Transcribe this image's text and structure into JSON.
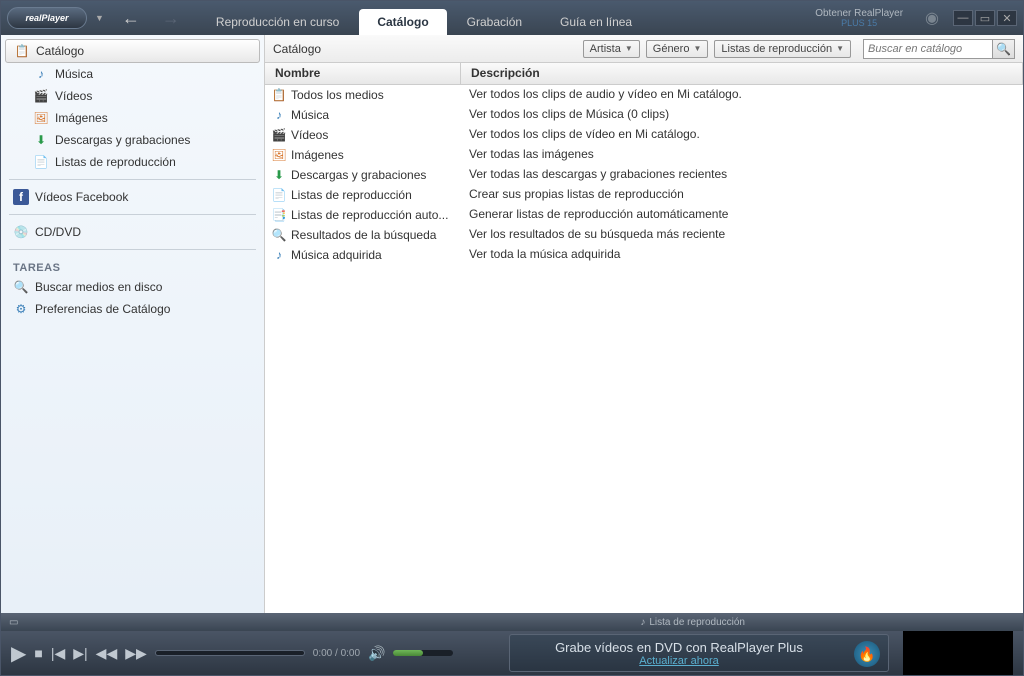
{
  "titlebar": {
    "logo": "realPlayer",
    "tabs": [
      {
        "label": "Reproducción en curso",
        "active": false
      },
      {
        "label": "Catálogo",
        "active": true
      },
      {
        "label": "Grabación",
        "active": false
      },
      {
        "label": "Guía en línea",
        "active": false
      }
    ],
    "plus_line1": "Obtener RealPlayer",
    "plus_line2": "PLUS 15"
  },
  "toolbar": {
    "label": "Catálogo",
    "dropdowns": [
      "Artista",
      "Género",
      "Listas de reproducción"
    ],
    "search_placeholder": "Buscar en catálogo"
  },
  "sidebar": {
    "main": [
      {
        "label": "Catálogo",
        "icon": "catalog",
        "selected": true,
        "indent": false
      },
      {
        "label": "Música",
        "icon": "music",
        "selected": false,
        "indent": true
      },
      {
        "label": "Vídeos",
        "icon": "video",
        "selected": false,
        "indent": true
      },
      {
        "label": "Imágenes",
        "icon": "image",
        "selected": false,
        "indent": true
      },
      {
        "label": "Descargas y grabaciones",
        "icon": "download",
        "selected": false,
        "indent": true
      },
      {
        "label": "Listas de reproducción",
        "icon": "playlist",
        "selected": false,
        "indent": true
      }
    ],
    "fb": {
      "label": "Vídeos Facebook",
      "icon": "facebook"
    },
    "cd": {
      "label": "CD/DVD",
      "icon": "disc"
    },
    "tasks_header": "TAREAS",
    "tasks": [
      {
        "label": "Buscar medios en disco",
        "icon": "search-disc"
      },
      {
        "label": "Preferencias de Catálogo",
        "icon": "prefs"
      }
    ]
  },
  "columns": {
    "name": "Nombre",
    "desc": "Descripción"
  },
  "rows": [
    {
      "icon": "catalog",
      "name": "Todos los medios",
      "desc": "Ver todos los clips de audio y vídeo en Mi catálogo."
    },
    {
      "icon": "music",
      "name": "Música",
      "desc": "Ver todos los clips de Música (0 clips)"
    },
    {
      "icon": "video",
      "name": "Vídeos",
      "desc": "Ver todos los clips de vídeo en Mi catálogo."
    },
    {
      "icon": "image",
      "name": "Imágenes",
      "desc": "Ver todas las imágenes"
    },
    {
      "icon": "download",
      "name": "Descargas y grabaciones",
      "desc": "Ver todas las descargas y grabaciones recientes"
    },
    {
      "icon": "playlist",
      "name": "Listas de reproducción",
      "desc": "Crear sus propias listas de reproducción"
    },
    {
      "icon": "playlist-auto",
      "name": "Listas de reproducción auto...",
      "desc": "Generar listas de reproducción automáticamente"
    },
    {
      "icon": "search",
      "name": "Resultados de la búsqueda",
      "desc": "Ver los resultados de su búsqueda más reciente"
    },
    {
      "icon": "music",
      "name": "Música adquirida",
      "desc": "Ver toda la música adquirida"
    }
  ],
  "bottombar": {
    "playlist": "Lista de reproducción"
  },
  "player": {
    "time": "0:00 / 0:00",
    "promo_text": "Grabe vídeos en DVD con RealPlayer Plus",
    "promo_link": "Actualizar ahora"
  },
  "icons": {
    "catalog": "📋",
    "music": "♪",
    "video": "🎬",
    "image": "🖼",
    "download": "⬇",
    "playlist": "📄",
    "playlist-auto": "📑",
    "search": "🔍",
    "facebook": "f",
    "disc": "💿",
    "search-disc": "🔍",
    "prefs": "⚙"
  },
  "icon_colors": {
    "catalog": "#3a7fb8",
    "music": "#3a7fb8",
    "video": "#8a3ab8",
    "image": "#d87830",
    "download": "#2a9a4a",
    "playlist": "#3aa858",
    "playlist-auto": "#3a7fb8",
    "search": "#3a7fb8",
    "facebook": "#3b5998",
    "disc": "#3a7fb8",
    "search-disc": "#3a7fb8",
    "prefs": "#3a7fb8"
  }
}
